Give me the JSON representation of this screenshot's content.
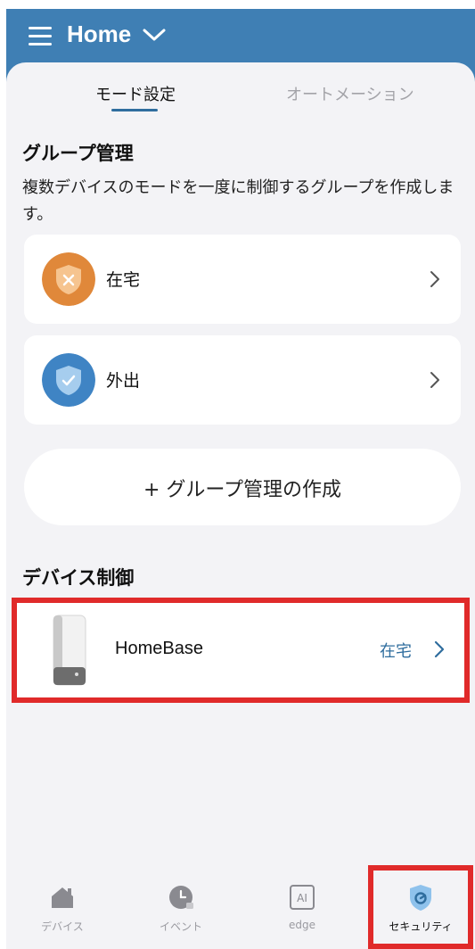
{
  "header": {
    "title": "Home"
  },
  "tabs": [
    {
      "label": "モード設定",
      "active": true
    },
    {
      "label": "オートメーション",
      "active": false
    }
  ],
  "group_section": {
    "title": "グループ管理",
    "description": "複数デバイスのモードを一度に制御するグループを作成します。",
    "groups": [
      {
        "label": "在宅",
        "icon": "shield-x-icon",
        "color": "#e0883a"
      },
      {
        "label": "外出",
        "icon": "shield-check-icon",
        "color": "#3f84c4"
      }
    ],
    "create_button": "+ グループ管理の作成"
  },
  "device_section": {
    "title": "デバイス制御",
    "device": {
      "name": "HomeBase",
      "status": "在宅"
    }
  },
  "bottom_nav": [
    {
      "label": "デバイス",
      "icon": "home-icon",
      "active": false
    },
    {
      "label": "イベント",
      "icon": "clock-icon",
      "active": false
    },
    {
      "label": "edge",
      "icon": "ai-icon",
      "active": false
    },
    {
      "label": "セキュリティ",
      "icon": "security-shield-icon",
      "active": true
    }
  ],
  "colors": {
    "header": "#3f7fb4",
    "accent": "#2f6d9e",
    "highlight": "#e02a2a",
    "background": "#f3f3f6"
  }
}
